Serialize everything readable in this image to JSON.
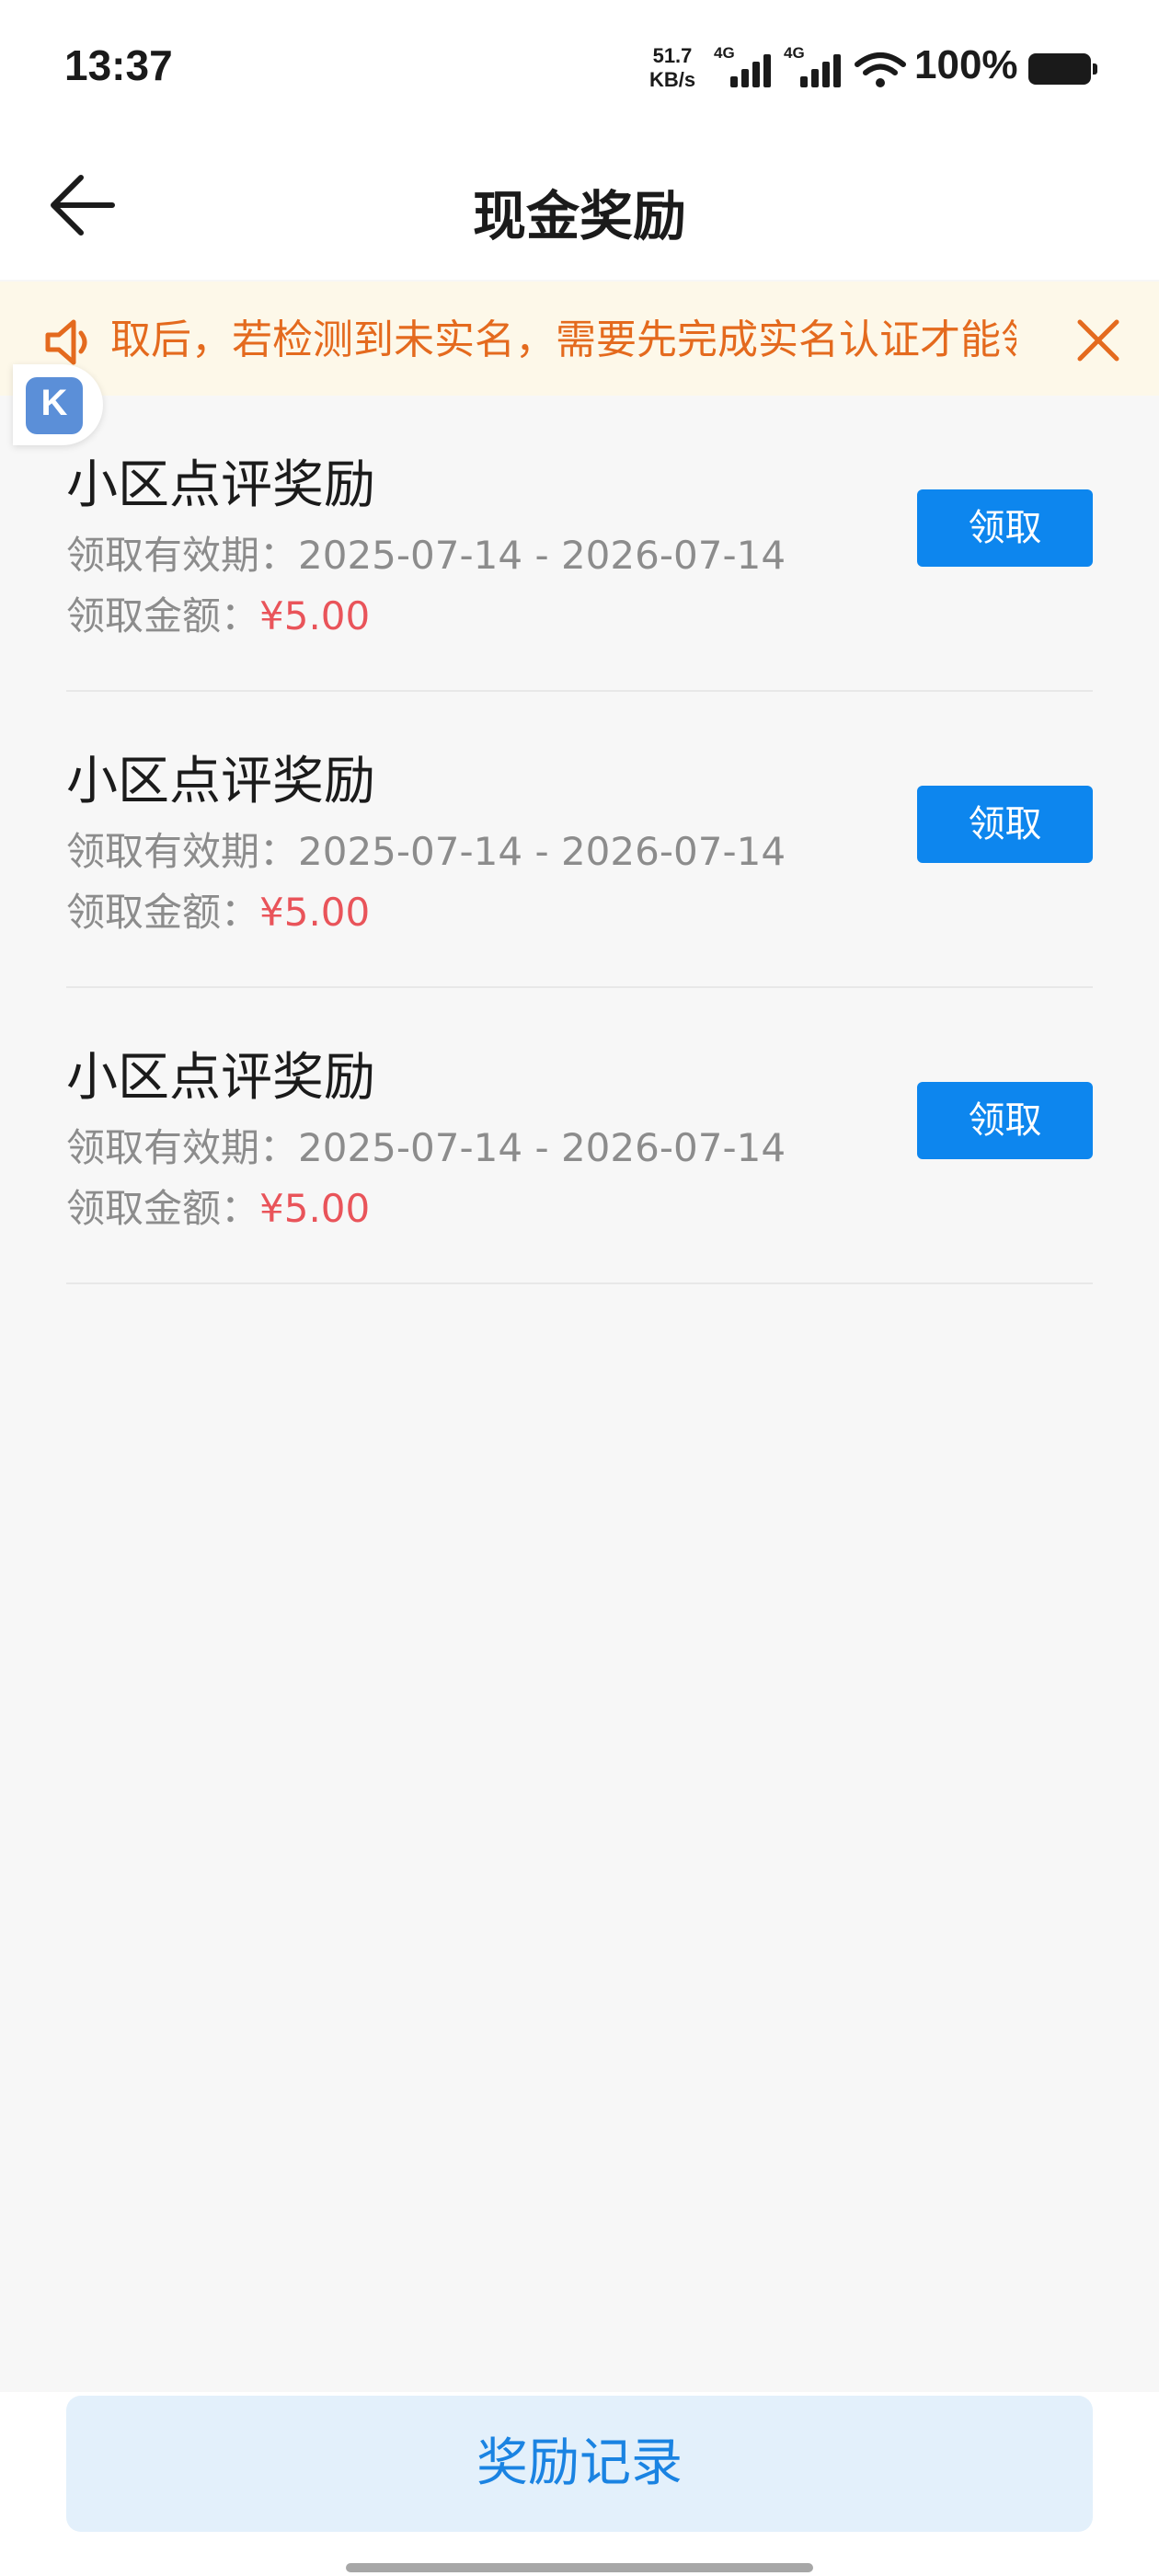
{
  "status_bar": {
    "time": "13:37",
    "net_speed_value": "51.7",
    "net_speed_unit": "KB/s",
    "signal_1_label": "4G",
    "signal_2_label": "4G",
    "battery_percent": "100%"
  },
  "header": {
    "title": "现金奖励",
    "back_icon": "arrow-left-icon"
  },
  "notice": {
    "icon": "speaker-icon",
    "text": "取后，若检测到未实名，需要先完成实名认证才能领取",
    "close_icon": "close-icon",
    "text_color": "#e46a1e",
    "background": "#fdf8e9"
  },
  "rewards": [
    {
      "title": "小区点评奖励",
      "date_label": "领取有效期：",
      "date_range": "2025-07-14 - 2026-07-14",
      "amount_label": "领取金额：",
      "amount": "¥5.00",
      "button_label": "领取"
    },
    {
      "title": "小区点评奖励",
      "date_label": "领取有效期：",
      "date_range": "2025-07-14 - 2026-07-14",
      "amount_label": "领取金额：",
      "amount": "¥5.00",
      "button_label": "领取"
    },
    {
      "title": "小区点评奖励",
      "date_label": "领取有效期：",
      "date_range": "2025-07-14 - 2026-07-14",
      "amount_label": "领取金额：",
      "amount": "¥5.00",
      "button_label": "领取"
    }
  ],
  "bottom": {
    "record_button_label": "奖励记录"
  },
  "colors": {
    "primary": "#0d86ee",
    "amount": "#e9545a",
    "record_bg": "#e3f0fb",
    "record_text": "#1a83e2"
  }
}
